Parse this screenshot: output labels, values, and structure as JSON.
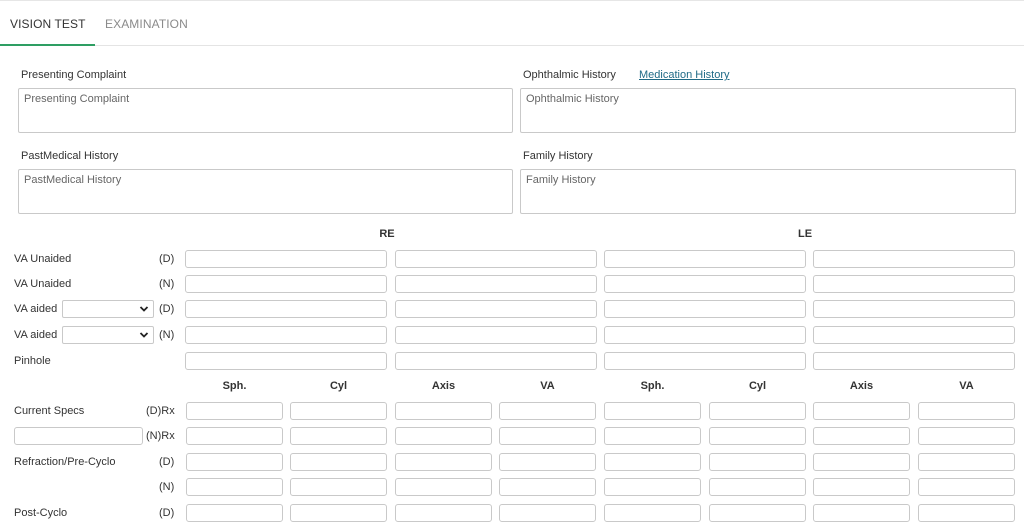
{
  "tabs": [
    {
      "label": "VISION TEST",
      "active": true
    },
    {
      "label": "EXAMINATION",
      "active": false
    }
  ],
  "history": {
    "presenting_complaint": {
      "label": "Presenting Complaint",
      "placeholder": "Presenting Complaint"
    },
    "ophthalmic_history": {
      "label": "Ophthalmic History",
      "placeholder": "Ophthalmic History"
    },
    "medication_history_link": "Medication History",
    "past_medical_history": {
      "label": "PastMedical History",
      "placeholder": "PastMedical History"
    },
    "family_history": {
      "label": "Family History",
      "placeholder": "Family History"
    }
  },
  "eyes": {
    "right": "RE",
    "left": "LE"
  },
  "va_rows": [
    {
      "label": "VA Unaided",
      "eye": "(D)"
    },
    {
      "label": "VA Unaided",
      "eye": "(N)"
    },
    {
      "label": "VA aided",
      "eye": "(D)",
      "select_value": ""
    },
    {
      "label": "VA aided",
      "eye": "(N)",
      "select_value": ""
    },
    {
      "label": "Pinhole",
      "eye": ""
    }
  ],
  "rx_columns": [
    "Sph.",
    "Cyl",
    "Axis",
    "VA",
    "Sph.",
    "Cyl",
    "Axis",
    "VA"
  ],
  "rx_rows": [
    {
      "label": "Current Specs",
      "eye": "(D)Rx"
    },
    {
      "label": "",
      "eye": "(N)Rx",
      "input_value": ""
    },
    {
      "label": "Refraction/Pre-Cyclo",
      "eye": "(D)"
    },
    {
      "label": "",
      "eye": "(N)"
    },
    {
      "label": "Post-Cyclo",
      "eye": "(D)"
    }
  ],
  "colors": {
    "accent": "#2e9e63",
    "link": "#1f6a86",
    "border": "#c9c9c9"
  }
}
